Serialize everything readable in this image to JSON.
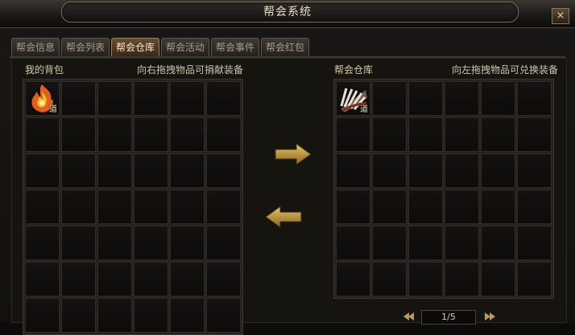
{
  "window": {
    "title": "帮会系统",
    "close_label": "×"
  },
  "tabs": [
    {
      "label": "帮会信息",
      "active": false
    },
    {
      "label": "帮会列表",
      "active": false
    },
    {
      "label": "帮会仓库",
      "active": true
    },
    {
      "label": "帮会活动",
      "active": false
    },
    {
      "label": "帮会事件",
      "active": false
    },
    {
      "label": "帮会红包",
      "active": false
    }
  ],
  "bag": {
    "title": "我的背包",
    "hint": "向右拖拽物品可捐献装备",
    "item_tag": "道",
    "item_icon": "flame-icon"
  },
  "warehouse": {
    "title": "帮会仓库",
    "hint": "向左拖拽物品可兑换装备",
    "item_tag": "道",
    "item_icon": "scroll-fan-icon"
  },
  "pager": {
    "page": "1/5"
  },
  "colors": {
    "accent": "#c8a24a",
    "tab_active": "#6b4c2f"
  }
}
